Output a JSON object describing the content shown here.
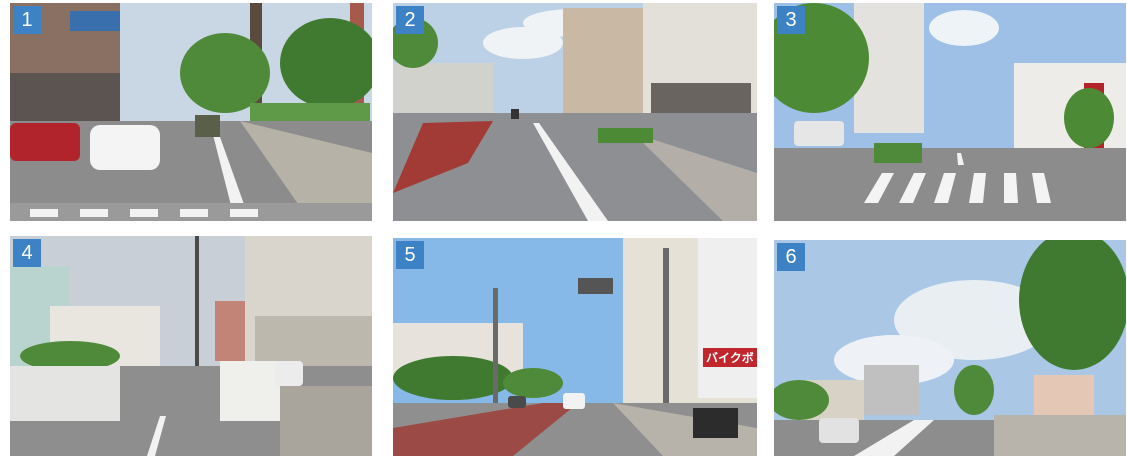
{
  "panels": [
    {
      "label": "1"
    },
    {
      "label": "2"
    },
    {
      "label": "3"
    },
    {
      "label": "4"
    },
    {
      "label": "5",
      "shop_sign": "バイクボ"
    },
    {
      "label": "6"
    }
  ],
  "colors": {
    "badge": "#3d82c4",
    "sky": "#c8d8e8",
    "road": "#8a8a8a",
    "building": "#d8d4cc",
    "tree": "#4f8a3a",
    "sign_red": "#c0262b"
  }
}
